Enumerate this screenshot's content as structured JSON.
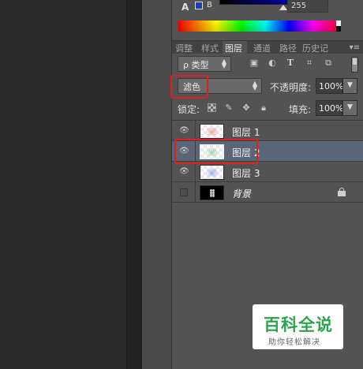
{
  "color_panel": {
    "channel_label": "B",
    "channel_value": "255",
    "channel_color": "#1d3fa8"
  },
  "tabs": [
    {
      "label": "调整",
      "active": false
    },
    {
      "label": "样式",
      "active": false
    },
    {
      "label": "图层",
      "active": true
    },
    {
      "label": "通道",
      "active": false
    },
    {
      "label": "路径",
      "active": false
    },
    {
      "label": "历史记",
      "active": false
    }
  ],
  "filter": {
    "kind_label": "ρ 类型"
  },
  "blend": {
    "mode": "滤色",
    "opacity_label": "不透明度:",
    "opacity_value": "100%"
  },
  "lock": {
    "label": "锁定:",
    "fill_label": "填充:",
    "fill_value": "100%"
  },
  "layers": [
    {
      "name": "图层 1",
      "visible": true,
      "selected": false
    },
    {
      "name": "图层 2",
      "visible": true,
      "selected": true
    },
    {
      "name": "图层 3",
      "visible": true,
      "selected": false
    },
    {
      "name": "背景",
      "visible": false,
      "selected": false,
      "locked": true
    }
  ],
  "watermark": {
    "title": "百科全说",
    "subtitle": "助你轻松解决"
  },
  "colors": {
    "highlight": "#e0201a",
    "selected_row": "#5a6577",
    "watermark_green": "#2ca44e"
  }
}
